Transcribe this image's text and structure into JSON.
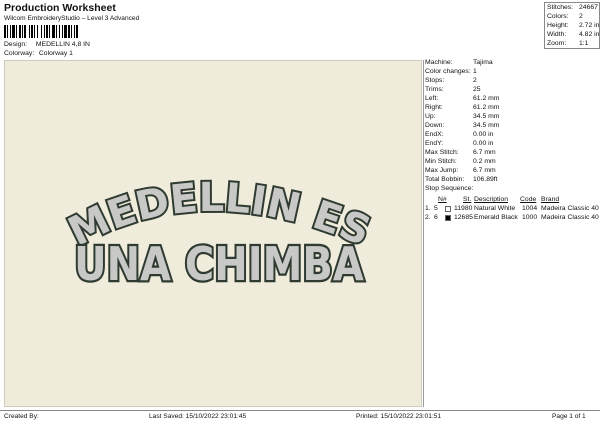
{
  "header": {
    "title": "Production Worksheet",
    "software": "Wilcom EmbroideryStudio – Level 3 Advanced"
  },
  "meta": {
    "design_label": "Design:",
    "design_value": "MEDELLIN 4,8 IN",
    "colorway_label": "Colorway:",
    "colorway_value": "Colorway 1"
  },
  "summary": [
    {
      "label": "Stitches:",
      "value": "24667"
    },
    {
      "label": "Colors:",
      "value": "2"
    },
    {
      "label": "Height:",
      "value": "2.72 in"
    },
    {
      "label": "Width:",
      "value": "4.82 in"
    },
    {
      "label": "Zoom:",
      "value": "1:1"
    }
  ],
  "design_text": {
    "line1": "MEDELLIN ES",
    "line2": "UNA CHIMBA"
  },
  "colors": {
    "fabric": "#efecdc",
    "fill": "#c8c9c6",
    "outline": "#2f3a31",
    "thread_white": "#ffffff",
    "thread_black": "#000000"
  },
  "machine_info": [
    {
      "label": "Machine:",
      "value": "Tajima"
    },
    {
      "label": "Color changes:",
      "value": "1"
    },
    {
      "label": "Stops:",
      "value": "2"
    },
    {
      "label": "Trims:",
      "value": "25"
    },
    {
      "label": "Left:",
      "value": "61.2 mm"
    },
    {
      "label": "Right:",
      "value": "61.2 mm"
    },
    {
      "label": "Up:",
      "value": "34.5 mm"
    },
    {
      "label": "Down:",
      "value": "34.5 mm"
    },
    {
      "label": "EndX:",
      "value": "0.00 in"
    },
    {
      "label": "EndY:",
      "value": "0.00 in"
    },
    {
      "label": "Max Stitch:",
      "value": "6.7 mm"
    },
    {
      "label": "Min Stitch:",
      "value": "0.2 mm"
    },
    {
      "label": "Max Jump:",
      "value": "6.7 mm"
    },
    {
      "label": "Total Bobbin:",
      "value": "106.89ft"
    }
  ],
  "stop_sequence": {
    "title": "Stop Sequence:",
    "columns": [
      "N#",
      "St.",
      "Description",
      "Code",
      "Brand"
    ],
    "rows": [
      {
        "stop": "1.",
        "n": "5",
        "stitches": "11980",
        "description": "Natural White",
        "code": "1004",
        "brand": "Madeira Classic 40"
      },
      {
        "stop": "2.",
        "n": "6",
        "stitches": "12685",
        "description": "Emerald Black",
        "code": "1000",
        "brand": "Madeira Classic 40"
      }
    ]
  },
  "footer": {
    "created_by": "Created By:",
    "last_saved": "Last Saved: 15/10/2022 23:01:45",
    "printed": "Printed: 15/10/2022 23:01:51",
    "page": "Page 1 of 1"
  }
}
